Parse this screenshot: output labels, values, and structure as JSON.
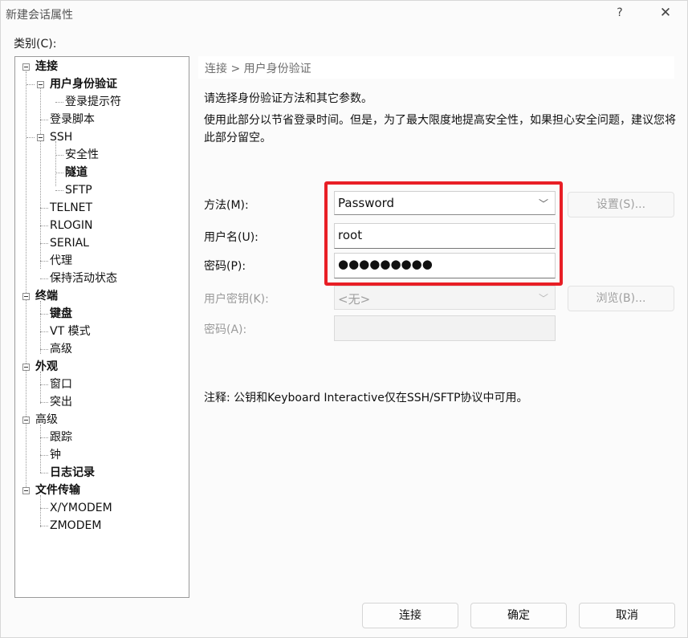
{
  "window": {
    "title": "新建会话属性",
    "help": "?",
    "close": "✕"
  },
  "category_label": "类别(C):",
  "tree": [
    {
      "label": "连接",
      "bold": true
    },
    {
      "label": "用户身份验证",
      "bold": true
    },
    {
      "label": "登录提示符",
      "bold": false
    },
    {
      "label": "登录脚本",
      "bold": false
    },
    {
      "label": "SSH",
      "bold": false
    },
    {
      "label": "安全性",
      "bold": false
    },
    {
      "label": "隧道",
      "bold": true
    },
    {
      "label": "SFTP",
      "bold": false
    },
    {
      "label": "TELNET",
      "bold": false
    },
    {
      "label": "RLOGIN",
      "bold": false
    },
    {
      "label": "SERIAL",
      "bold": false
    },
    {
      "label": "代理",
      "bold": false
    },
    {
      "label": "保持活动状态",
      "bold": false
    },
    {
      "label": "终端",
      "bold": true
    },
    {
      "label": "键盘",
      "bold": true
    },
    {
      "label": "VT 模式",
      "bold": false
    },
    {
      "label": "高级",
      "bold": false
    },
    {
      "label": "外观",
      "bold": true
    },
    {
      "label": "窗口",
      "bold": false
    },
    {
      "label": "突出",
      "bold": false
    },
    {
      "label": "高级",
      "bold": false
    },
    {
      "label": "跟踪",
      "bold": false
    },
    {
      "label": "钟",
      "bold": false
    },
    {
      "label": "日志记录",
      "bold": true
    },
    {
      "label": "文件传输",
      "bold": true
    },
    {
      "label": "X/YMODEM",
      "bold": false
    },
    {
      "label": "ZMODEM",
      "bold": false
    }
  ],
  "breadcrumb": "连接 > 用户身份验证",
  "intro": "请选择身份验证方法和其它参数。",
  "description": "使用此部分以节省登录时间。但是，为了最大限度地提高安全性，如果担心安全问题，建议您将此部分留空。",
  "form": {
    "method_label": "方法(M):",
    "method_value": "Password",
    "settings_button": "设置(S)...",
    "username_label": "用户名(U):",
    "username_value": "root",
    "password_label": "密码(P):",
    "password_value": "●●●●●●●●●",
    "userkey_label": "用户密钥(K):",
    "userkey_value": "<无>",
    "browse_button": "浏览(B)...",
    "passphrase_label": "密码(A):",
    "passphrase_value": ""
  },
  "note": "注释: 公钥和Keyboard Interactive仅在SSH/SFTP协议中可用。",
  "buttons": {
    "connect": "连接",
    "ok": "确定",
    "cancel": "取消"
  },
  "colors": {
    "highlight": "#e81e25",
    "disabled_text": "#9a9a9a"
  }
}
